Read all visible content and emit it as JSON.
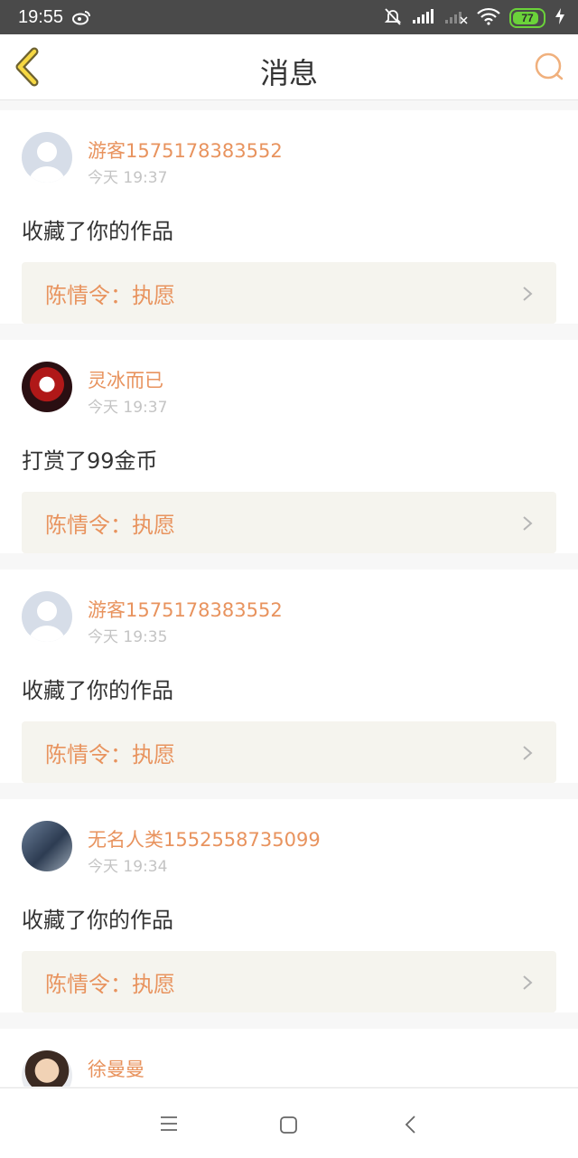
{
  "status": {
    "time": "19:55",
    "battery": "77"
  },
  "header": {
    "title": "消息"
  },
  "messages": [
    {
      "name": "游客1575178383552",
      "time": "今天 19:37",
      "action": "收藏了你的作品",
      "work": "陈情令：执愿"
    },
    {
      "name": "灵冰而已",
      "time": "今天 19:37",
      "action": "打赏了99金币",
      "work": "陈情令：执愿"
    },
    {
      "name": "游客1575178383552",
      "time": "今天 19:35",
      "action": "收藏了你的作品",
      "work": "陈情令：执愿"
    },
    {
      "name": "无名人类1552558735099",
      "time": "今天 19:34",
      "action": "收藏了你的作品",
      "work": "陈情令：执愿"
    },
    {
      "name": "徐曼曼"
    }
  ]
}
